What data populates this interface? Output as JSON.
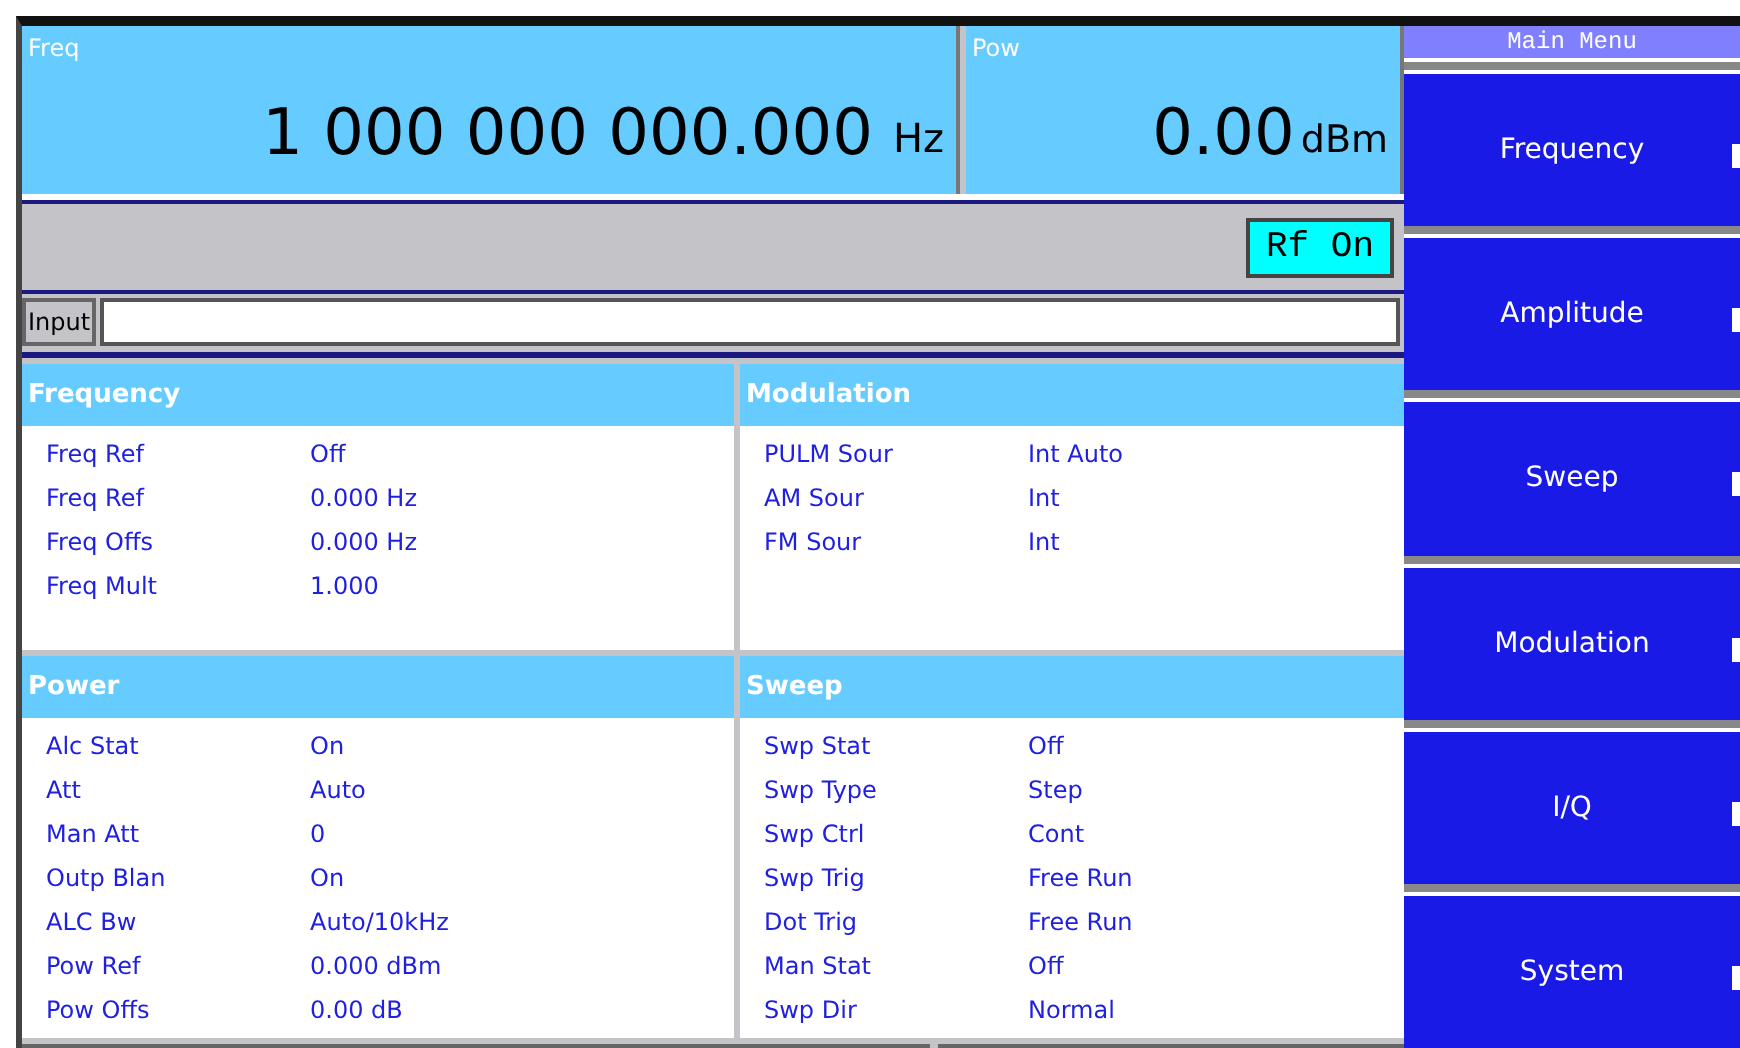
{
  "readouts": [
    {
      "label": "Freq",
      "value": "1 000 000 000.000",
      "unit": "Hz",
      "kind": "freq"
    },
    {
      "label": "Pow",
      "value": "0.00",
      "unit": "dBm",
      "kind": "pow"
    }
  ],
  "rf_button": {
    "label": "Rf On"
  },
  "input": {
    "label": "Input"
  },
  "panels": [
    {
      "title": "Frequency",
      "rows": [
        [
          "Freq Ref",
          "Off"
        ],
        [
          "Freq Ref",
          "0.000 Hz"
        ],
        [
          "Freq Offs",
          "0.000 Hz"
        ],
        [
          "Freq Mult",
          "1.000"
        ]
      ]
    },
    {
      "title": "Modulation",
      "rows": [
        [
          "PULM Sour",
          "Int Auto"
        ],
        [
          "AM Sour",
          "Int"
        ],
        [
          "FM Sour",
          "Int"
        ]
      ]
    },
    {
      "title": "Power",
      "rows": [
        [
          "Alc Stat",
          "On"
        ],
        [
          "Att",
          "Auto"
        ],
        [
          "Man Att",
          "0"
        ],
        [
          "Outp Blan",
          "On"
        ],
        [
          "ALC Bw",
          "Auto/10kHz"
        ],
        [
          "Pow Ref",
          "0.000 dBm"
        ],
        [
          "Pow Offs",
          "0.00 dB"
        ]
      ]
    },
    {
      "title": "Sweep",
      "rows": [
        [
          "Swp Stat",
          "Off"
        ],
        [
          "Swp Type",
          "Step"
        ],
        [
          "Swp Ctrl",
          "Cont"
        ],
        [
          "Swp Trig",
          "Free Run"
        ],
        [
          "Dot Trig",
          "Free Run"
        ],
        [
          "Man Stat",
          "Off"
        ],
        [
          "Swp Dir",
          "Normal"
        ]
      ]
    }
  ],
  "menu": {
    "title": "Main Menu",
    "items": [
      "Frequency",
      "Amplitude",
      "Sweep",
      "Modulation",
      "I/Q",
      "System"
    ]
  }
}
